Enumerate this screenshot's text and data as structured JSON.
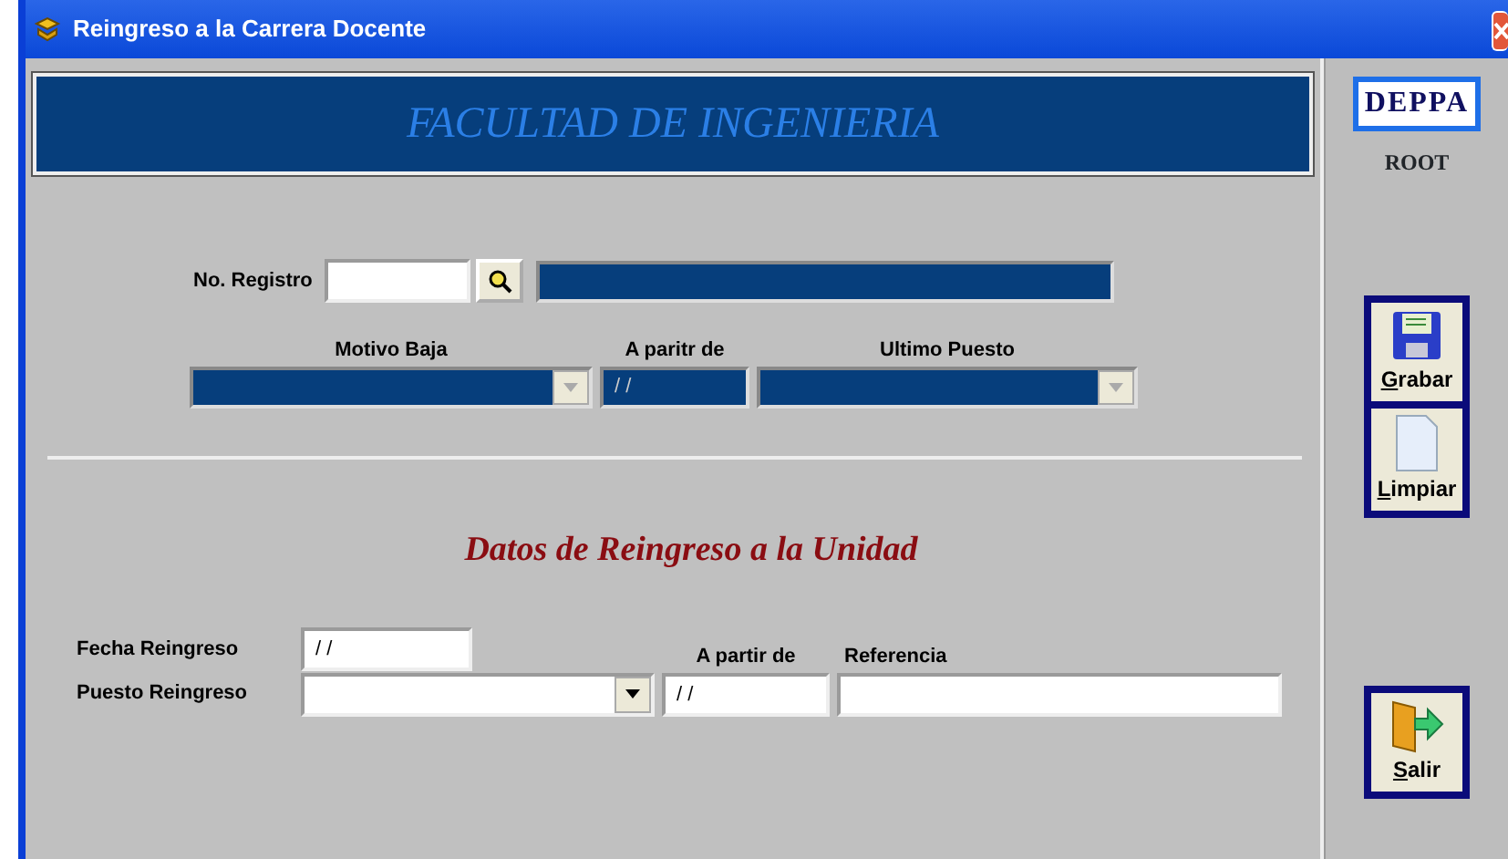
{
  "window": {
    "title": "Reingreso a la Carrera Docente"
  },
  "banner": "FACULTAD DE INGENIERIA",
  "registro": {
    "label": "No. Registro"
  },
  "baja": {
    "motivo_label": "Motivo Baja",
    "fecha_label": "A paritr de",
    "fecha_value": "/ /",
    "puesto_label": "Ultimo Puesto"
  },
  "section_title": "Datos de Reingreso a la Unidad",
  "reingreso": {
    "fecha_label": "Fecha Reingreso",
    "fecha_value": "/ /",
    "puesto_label": "Puesto Reingreso",
    "desde_label": "A partir de",
    "desde_value": "/ /",
    "referencia_label": "Referencia"
  },
  "sidebar": {
    "logo": "DEPPA",
    "user": "ROOT",
    "buttons": [
      {
        "kind": "save",
        "label": "Grabar",
        "underline_first": true
      },
      {
        "kind": "clear",
        "label": "Limpiar",
        "underline_first": true
      },
      {
        "kind": "exit",
        "label": "Salir",
        "underline_first": true
      }
    ]
  }
}
